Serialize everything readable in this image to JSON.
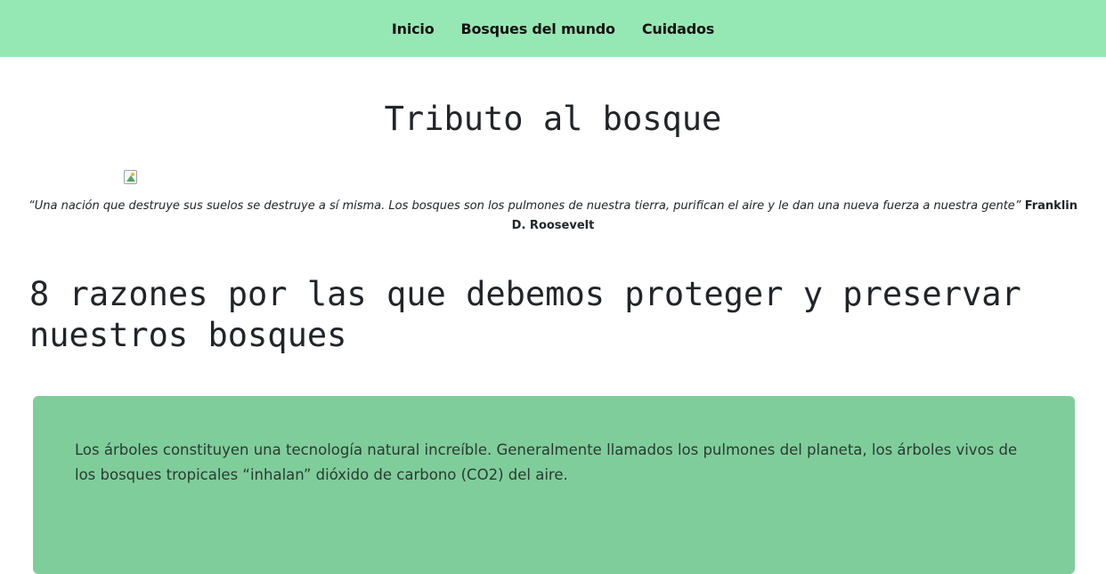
{
  "nav": {
    "items": [
      "Inicio",
      "Bosques del mundo",
      "Cuidados"
    ]
  },
  "page": {
    "title": "Tributo al bosque"
  },
  "quote": {
    "text": "“Una nación que destruye sus suelos se destruye a sí misma. Los bosques son los pulmones de nuestra tierra, purifican el aire y le dan una nueva fuerza a nuestra gente”",
    "author": "Franklin D. Roosevelt"
  },
  "section": {
    "heading": "8 razones por las que debemos proteger y preservar nuestros bosques"
  },
  "reasons": [
    {
      "text": "Los árboles constituyen una tecnología natural increíble. Generalmente llamados los pulmones del planeta, los árboles vivos de los bosques tropicales “inhalan” dióxido de carbono (CO2) del aire."
    }
  ],
  "colors": {
    "navbar": "#95e8b4",
    "card": "#80cd9c"
  },
  "icons": {
    "header_image": "broken-image-icon"
  }
}
